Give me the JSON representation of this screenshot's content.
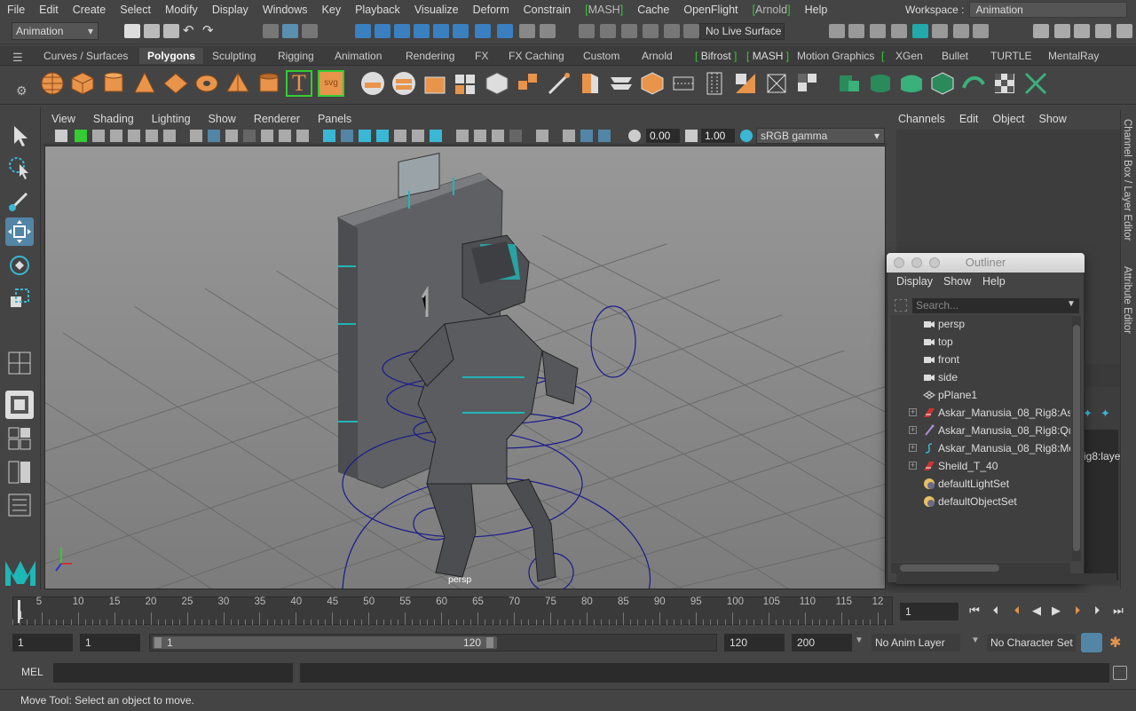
{
  "menubar": {
    "items": [
      "File",
      "Edit",
      "Create",
      "Select",
      "Modify",
      "Display",
      "Windows",
      "Key",
      "Playback",
      "Visualize",
      "Deform",
      "Constrain"
    ],
    "mash": "MASH",
    "items2": [
      "Cache",
      "OpenFlight"
    ],
    "arnold": "Arnold",
    "help": "Help"
  },
  "workspace": {
    "label": "Workspace :",
    "value": "Animation"
  },
  "statusline": {
    "mode": "Animation",
    "live_surface": "No Live Surface"
  },
  "shelf_tabs": [
    "Curves / Surfaces",
    "Polygons",
    "Sculpting",
    "Rigging",
    "Animation",
    "Rendering",
    "FX",
    "FX Caching",
    "Custom",
    "Arnold",
    "Bifrost",
    "MASH",
    "Motion Graphics",
    "XGen",
    "Bullet",
    "TURTLE",
    "MentalRay"
  ],
  "shelf_active": "Polygons",
  "viewport_menu": [
    "View",
    "Shading",
    "Lighting",
    "Show",
    "Renderer",
    "Panels"
  ],
  "viewport_toolbar": {
    "exposure": "0.00",
    "gamma_value": "1.00",
    "color_space": "sRGB gamma"
  },
  "viewport": {
    "camera_label": "persp"
  },
  "channel_box_menu": [
    "Channels",
    "Edit",
    "Object",
    "Show"
  ],
  "side_tabs": {
    "channel_box": "Channel Box / Layer Editor",
    "attribute_editor": "Attribute Editor"
  },
  "behind_text": "ig8:layer",
  "outliner": {
    "title": "Outliner",
    "menu": [
      "Display",
      "Show",
      "Help"
    ],
    "search_placeholder": "Search...",
    "rows": [
      {
        "name": "persp",
        "icon": "camera-icon",
        "expandable": false
      },
      {
        "name": "top",
        "icon": "camera-icon",
        "expandable": false
      },
      {
        "name": "front",
        "icon": "camera-icon",
        "expandable": false
      },
      {
        "name": "side",
        "icon": "camera-icon",
        "expandable": false
      },
      {
        "name": "pPlane1",
        "icon": "mesh-icon",
        "expandable": false
      },
      {
        "name": "Askar_Manusia_08_Rig8:Ask",
        "icon": "rig-icon",
        "expandable": true
      },
      {
        "name": "Askar_Manusia_08_Rig8:Qui",
        "icon": "joint-icon",
        "expandable": true
      },
      {
        "name": "Askar_Manusia_08_Rig8:Mo",
        "icon": "curve-icon",
        "expandable": true
      },
      {
        "name": "Sheild_T_40",
        "icon": "rig-icon",
        "expandable": true
      },
      {
        "name": "defaultLightSet",
        "icon": "set-icon",
        "expandable": false
      },
      {
        "name": "defaultObjectSet",
        "icon": "set-icon",
        "expandable": false
      }
    ]
  },
  "timeline": {
    "ticks": [
      "5",
      "10",
      "15",
      "20",
      "25",
      "30",
      "35",
      "40",
      "45",
      "50",
      "55",
      "60",
      "65",
      "70",
      "75",
      "80",
      "85",
      "90",
      "95",
      "100",
      "105",
      "110",
      "115",
      "12"
    ],
    "start_marker": "1",
    "current_frame": "1"
  },
  "range": {
    "start": "1",
    "start_inner": "1",
    "slider_start": "1",
    "slider_end": "120",
    "end": "120",
    "end_total": "200",
    "anim_layer": "No Anim Layer",
    "character_set": "No Character Set"
  },
  "cmdline": {
    "label": "MEL"
  },
  "help_line": "Move Tool: Select an object to move.",
  "colors": {
    "accent_teal": "#1fb6b6",
    "polygon_orange": "#e8944a",
    "viewport_bg": "#8b8b8b",
    "grid": "#6e6e6e",
    "rig_blue": "#1a1a8c"
  }
}
